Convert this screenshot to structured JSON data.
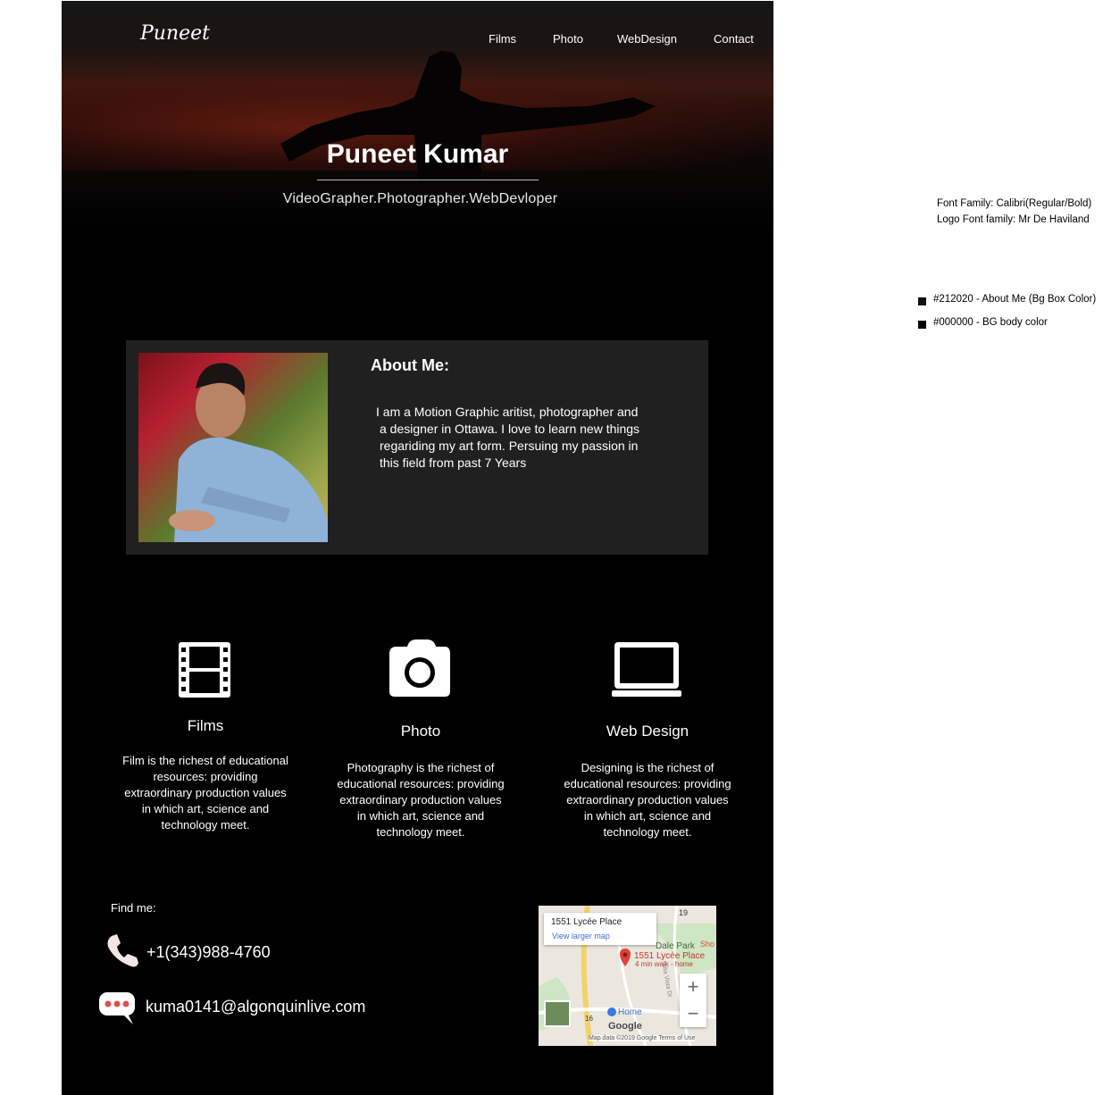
{
  "logo": {
    "text": "Puneet"
  },
  "nav": {
    "items": [
      {
        "label": "Films"
      },
      {
        "label": "Photo"
      },
      {
        "label": "WebDesign"
      },
      {
        "label": "Contact"
      }
    ]
  },
  "hero": {
    "name": "Puneet Kumar",
    "subtitle": "VideoGrapher.Photographer.WebDevloper"
  },
  "about": {
    "title": "About Me:",
    "lines": [
      "I  am a Motion Graphic aritist, photographer and",
      "a designer in Ottawa. I love to learn new things",
      "regariding my art form. Persuing my passion in",
      "this field from past 7 Years"
    ]
  },
  "services": [
    {
      "icon": "film-icon",
      "title": "Films",
      "lines": [
        "Film is the richest of educational",
        "resources: providing",
        "extraordinary production values",
        "in which art, science and",
        "technology meet."
      ]
    },
    {
      "icon": "camera-icon",
      "title": "Photo",
      "lines": [
        "Photography is the richest of",
        "educational resources: providing",
        "extraordinary production values",
        "in which art, science and",
        "technology meet."
      ]
    },
    {
      "icon": "laptop-icon",
      "title": "Web Design",
      "lines": [
        "Designing is the richest of",
        "educational resources: providing",
        "extraordinary production values",
        "in which art, science and",
        "technology meet."
      ]
    }
  ],
  "contact": {
    "label": "Find me:",
    "phone": "+1(343)988-4760",
    "email": "kuma0141@algonquinlive.com"
  },
  "map": {
    "address": "1551 Lycée Place",
    "link": "View larger map",
    "pin_label": "1551 Lycée Place",
    "pin_sub": "4 min walk - home",
    "home_label": "Home",
    "place_label": "Dale Park",
    "place_label_2": "Sho",
    "brand": "Google",
    "footer": "Map data ©2019 Google   Terms of Use",
    "road_1": "19",
    "road_2": "16",
    "road_3": "Alta Vista Dr",
    "zoom_in": "+",
    "zoom_out": "−"
  },
  "notes": {
    "font_family": "Font Family: Calibri(Regular/Bold)",
    "logo_font": "Logo Font family: Mr De Haviland",
    "color_about": "#212020 - About Me (Bg Box Color)",
    "color_body": "#000000 - BG body color"
  },
  "colors": {
    "about_bg": "#212020",
    "body_bg": "#000000"
  }
}
